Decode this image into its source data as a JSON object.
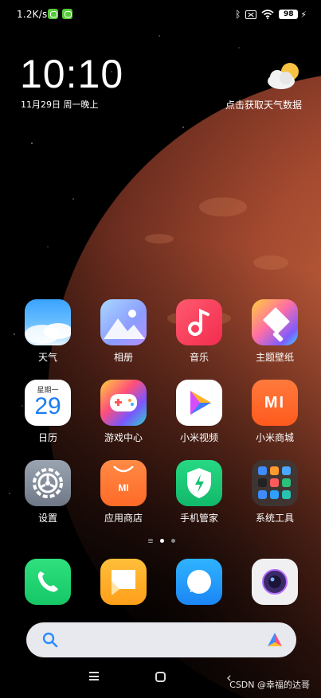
{
  "status_bar": {
    "network_speed": "1.2K/s",
    "battery": "98",
    "icons": [
      "wechat-icon",
      "wechat-icon",
      "bluetooth-icon",
      "no-sim-icon",
      "wifi-icon",
      "battery-icon",
      "charging-icon"
    ]
  },
  "clock_widget": {
    "time": "10:10",
    "date": "11月29日 周一晚上",
    "weather_prompt": "点击获取天气数据"
  },
  "apps": [
    {
      "label": "天气",
      "icon": "weather-app-icon"
    },
    {
      "label": "相册",
      "icon": "gallery-app-icon"
    },
    {
      "label": "音乐",
      "icon": "music-app-icon"
    },
    {
      "label": "主题壁纸",
      "icon": "themes-app-icon"
    },
    {
      "label": "日历",
      "icon": "calendar-app-icon",
      "weekday": "星期一",
      "day": "29"
    },
    {
      "label": "游戏中心",
      "icon": "game-center-app-icon"
    },
    {
      "label": "小米视频",
      "icon": "mi-video-app-icon"
    },
    {
      "label": "小米商城",
      "icon": "mi-store-app-icon",
      "logo_text": "mi"
    },
    {
      "label": "设置",
      "icon": "settings-app-icon"
    },
    {
      "label": "应用商店",
      "icon": "app-store-app-icon",
      "logo_text": "mi"
    },
    {
      "label": "手机管家",
      "icon": "security-app-icon"
    },
    {
      "label": "系统工具",
      "icon": "system-tools-folder-icon"
    }
  ],
  "dock": [
    {
      "icon": "phone-app-icon"
    },
    {
      "icon": "messages-app-icon"
    },
    {
      "icon": "browser-app-icon"
    },
    {
      "icon": "camera-app-icon"
    }
  ],
  "search_bar": {
    "icon": "search-icon",
    "logo": "assistant-logo-icon"
  },
  "page_indicator": {
    "pages": 2,
    "current": 1
  },
  "navigation": {
    "icons": [
      "menu-icon",
      "home-icon",
      "back-icon"
    ]
  },
  "watermark": "CSDN @幸福的达哥",
  "colors": {
    "wallpaper_planet": "#b0543a",
    "background": "#000000",
    "search_bar": "#e8e9ee"
  }
}
